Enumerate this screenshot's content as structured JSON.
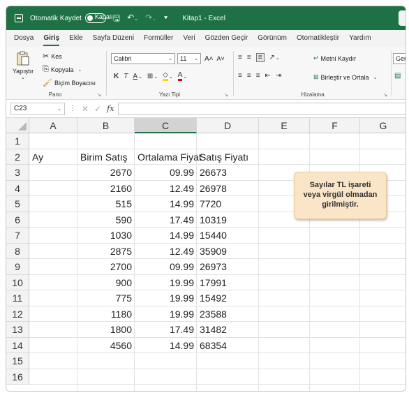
{
  "titlebar": {
    "autosave_label": "Otomatik Kaydet",
    "autosave_state": "Kapalı",
    "document_title": "Kitap1  -  Excel",
    "accent_color": "#1e7145"
  },
  "menu": {
    "tabs": [
      "Dosya",
      "Giriş",
      "Ekle",
      "Sayfa Düzeni",
      "Formüller",
      "Veri",
      "Gözden Geçir",
      "Görünüm",
      "Otomatikleştir",
      "Yardım"
    ],
    "active_tab": "Giriş"
  },
  "ribbon": {
    "clipboard": {
      "paste": "Yapıştır",
      "cut": "Kes",
      "copy": "Kopyala",
      "format_painter": "Biçim Boyacısı",
      "group_title": "Pano"
    },
    "font": {
      "font_name": "Calibri",
      "font_size": "11",
      "bold": "K",
      "italic": "T",
      "underline": "A",
      "grow": "A˄",
      "shrink": "A˅",
      "group_title": "Yazı Tipi"
    },
    "alignment": {
      "wrap_text": "Metni Kaydır",
      "merge_center": "Birleştir ve Ortala",
      "group_title": "Hizalama"
    },
    "number": {
      "format": "Genel"
    }
  },
  "formula_bar": {
    "name_box": "C23",
    "fx": "fx",
    "value": ""
  },
  "sheet": {
    "columns": [
      "A",
      "B",
      "C",
      "D",
      "E",
      "F",
      "G"
    ],
    "selected_column": "C",
    "rows": [
      "1",
      "2",
      "3",
      "4",
      "5",
      "6",
      "7",
      "8",
      "9",
      "10",
      "11",
      "12",
      "13",
      "14",
      "15",
      "16"
    ],
    "headers": {
      "A": "Ay",
      "B": "Birim Satış",
      "C": "Ortalama Fiyat",
      "D": "Satış Fiyatı"
    },
    "data": [
      {
        "B": "2670",
        "C": "09.99",
        "D": "26673"
      },
      {
        "B": "2160",
        "C": "12.49",
        "D": "26978"
      },
      {
        "B": "515",
        "C": "14.99",
        "D": "7720"
      },
      {
        "B": "590",
        "C": "17.49",
        "D": "10319"
      },
      {
        "B": "1030",
        "C": "14.99",
        "D": "15440"
      },
      {
        "B": "2875",
        "C": "12.49",
        "D": "35909"
      },
      {
        "B": "2700",
        "C": "09.99",
        "D": "26973"
      },
      {
        "B": "900",
        "C": "19.99",
        "D": "17991"
      },
      {
        "B": "775",
        "C": "19.99",
        "D": "15492"
      },
      {
        "B": "1180",
        "C": "19.99",
        "D": "23588"
      },
      {
        "B": "1800",
        "C": "17.49",
        "D": "31482"
      },
      {
        "B": "4560",
        "C": "14.99",
        "D": "68354"
      }
    ]
  },
  "callout": {
    "line1": "Sayılar TL işareti",
    "line2": "veya virgül olmadan",
    "line3": "girilmiştir.",
    "background": "#fbe5c8"
  }
}
